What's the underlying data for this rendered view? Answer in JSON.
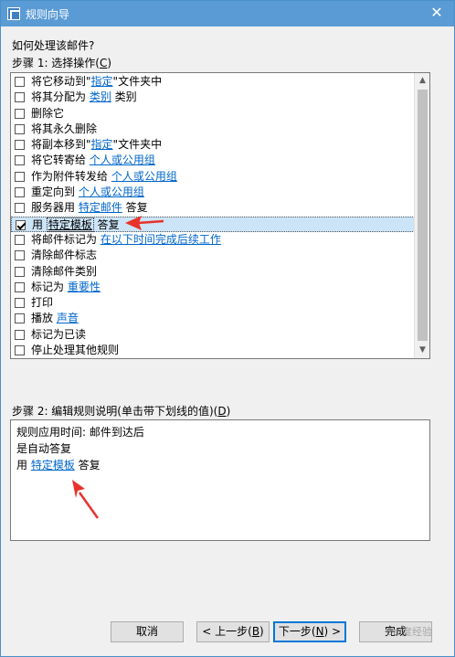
{
  "window": {
    "title": "规则向导",
    "close_glyph": "✕"
  },
  "question": "如何处理该邮件?",
  "step1": {
    "prefix": "步骤 1: 选择操作(",
    "key": "C",
    "suffix": ")"
  },
  "actions": [
    {
      "checked": false,
      "parts": [
        {
          "t": "将它移动到\""
        },
        {
          "t": "指定",
          "link": true
        },
        {
          "t": "\"文件夹中"
        }
      ]
    },
    {
      "checked": false,
      "parts": [
        {
          "t": "将其分配为 "
        },
        {
          "t": "类别",
          "link": true
        },
        {
          "t": " 类别"
        }
      ]
    },
    {
      "checked": false,
      "parts": [
        {
          "t": "删除它"
        }
      ]
    },
    {
      "checked": false,
      "parts": [
        {
          "t": "将其永久删除"
        }
      ]
    },
    {
      "checked": false,
      "parts": [
        {
          "t": "将副本移到\""
        },
        {
          "t": "指定",
          "link": true
        },
        {
          "t": "\"文件夹中"
        }
      ]
    },
    {
      "checked": false,
      "parts": [
        {
          "t": "将它转寄给 "
        },
        {
          "t": "个人或公用组",
          "link": true
        }
      ]
    },
    {
      "checked": false,
      "parts": [
        {
          "t": "作为附件转发给 "
        },
        {
          "t": "个人或公用组",
          "link": true
        }
      ]
    },
    {
      "checked": false,
      "parts": [
        {
          "t": "重定向到 "
        },
        {
          "t": "个人或公用组",
          "link": true
        }
      ]
    },
    {
      "checked": false,
      "parts": [
        {
          "t": "服务器用 "
        },
        {
          "t": "特定邮件",
          "link": true
        },
        {
          "t": " 答复"
        }
      ]
    },
    {
      "checked": true,
      "selected": true,
      "parts": [
        {
          "t": "用 "
        },
        {
          "t": "特定模板",
          "link": true,
          "box": true
        },
        {
          "t": " 答复"
        }
      ]
    },
    {
      "checked": false,
      "parts": [
        {
          "t": "将邮件标记为 "
        },
        {
          "t": "在以下时间完成后续工作",
          "link": true
        }
      ]
    },
    {
      "checked": false,
      "parts": [
        {
          "t": "清除邮件标志"
        }
      ]
    },
    {
      "checked": false,
      "parts": [
        {
          "t": "清除邮件类别"
        }
      ]
    },
    {
      "checked": false,
      "parts": [
        {
          "t": "标记为 "
        },
        {
          "t": "重要性",
          "link": true
        }
      ]
    },
    {
      "checked": false,
      "parts": [
        {
          "t": "打印"
        }
      ]
    },
    {
      "checked": false,
      "parts": [
        {
          "t": "播放 "
        },
        {
          "t": "声音",
          "link": true
        }
      ]
    },
    {
      "checked": false,
      "parts": [
        {
          "t": "标记为已读"
        }
      ]
    },
    {
      "checked": false,
      "parts": [
        {
          "t": "停止处理其他规则"
        }
      ]
    }
  ],
  "step2": {
    "prefix": "步骤 2: 编辑规则说明(单击带下划线的值)(",
    "key": "D",
    "suffix": ")"
  },
  "description": {
    "line1": "规则应用时间: 邮件到达后",
    "line2": "是自动答复",
    "line3_prefix": "用 ",
    "line3_link": "特定模板",
    "line3_suffix": " 答复"
  },
  "buttons": {
    "cancel": "取消",
    "back_prefix": "< 上一步(",
    "back_key": "B",
    "back_suffix": ")",
    "next_prefix": "下一步(",
    "next_key": "N",
    "next_suffix": ") >",
    "finish": "完成"
  },
  "watermark": "Bai度经验",
  "colors": {
    "title_bar": "#5b9bd5",
    "link": "#0066cc",
    "selection": "#cce4f7",
    "annotation_arrow": "#e8322b"
  }
}
